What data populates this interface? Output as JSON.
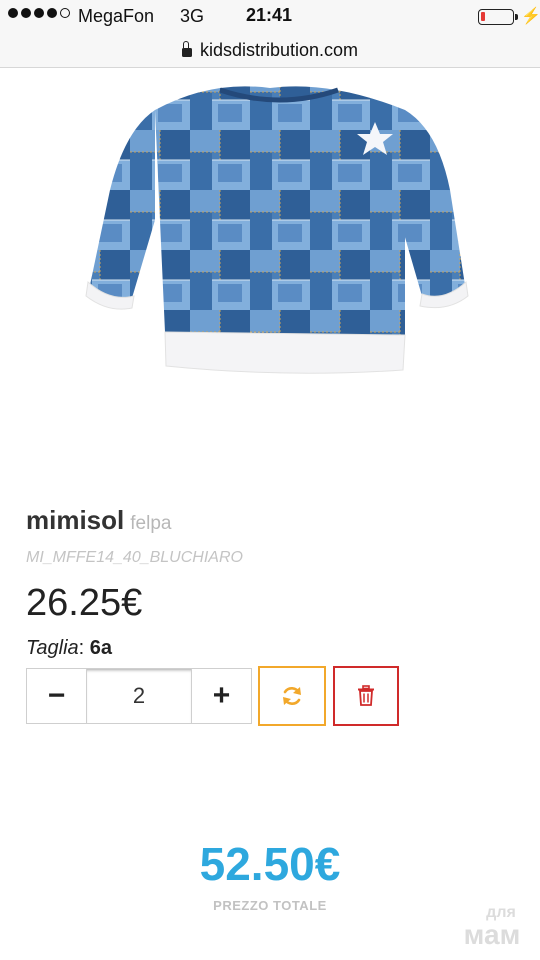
{
  "status_bar": {
    "carrier": "MegaFon",
    "network": "3G",
    "time": "21:41",
    "signal_dots": [
      1,
      1,
      1,
      1,
      0
    ],
    "battery_level": 0.12,
    "battery_color": "#e53935"
  },
  "browser": {
    "url": "kidsdistribution.com",
    "secure_icon": "lock-icon"
  },
  "product": {
    "brand": "mimisol",
    "category": "felpa",
    "sku": "MI_MFFE14_40_BLUCHIARO",
    "price": "26.25€",
    "size_label": "Taglia",
    "size_separator": ": ",
    "size_value": "6a",
    "image": "denim-print-sweatshirt"
  },
  "cart": {
    "decrement_label": "−",
    "increment_label": "+",
    "quantity": "2",
    "refresh_icon": "refresh-icon",
    "delete_icon": "trash-icon",
    "refresh_color": "#f2a82b",
    "delete_color": "#d02a2a"
  },
  "total": {
    "amount": "52.50€",
    "label": "PREZZO TOTALE",
    "color": "#2ea8de"
  },
  "watermark": {
    "top": "для",
    "bottom": "мам"
  }
}
